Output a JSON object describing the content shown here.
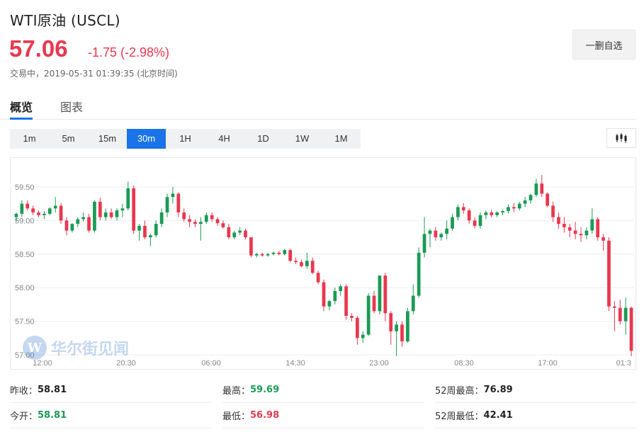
{
  "header": {
    "title": "WTI原油 (USCL)",
    "price": "57.06",
    "change": "-1.75 (-2.98%)",
    "status": "交易中，2019-05-31 01:39:35 (北京时间)"
  },
  "actions": {
    "watchlist_label": "一删自选"
  },
  "tabs": [
    {
      "label": "概览",
      "active": true
    },
    {
      "label": "图表",
      "active": false
    }
  ],
  "periods": [
    {
      "label": "1m",
      "active": false
    },
    {
      "label": "5m",
      "active": false
    },
    {
      "label": "15m",
      "active": false
    },
    {
      "label": "30m",
      "active": true
    },
    {
      "label": "1H",
      "active": false
    },
    {
      "label": "4H",
      "active": false
    },
    {
      "label": "1D",
      "active": false
    },
    {
      "label": "1W",
      "active": false
    },
    {
      "label": "1M",
      "active": false
    }
  ],
  "chart_type_icon": "candlestick-icon",
  "watermark": {
    "mark": "W",
    "text": "华尔街见闻"
  },
  "colors": {
    "up": "#1b9a55",
    "down": "#e8384f",
    "accent": "#1a73e8"
  },
  "chart_data": {
    "type": "candlestick",
    "ylim": [
      57.0,
      59.7
    ],
    "yticks": [
      "59.50",
      "59.00",
      "58.50",
      "58.00",
      "57.50",
      "57.00"
    ],
    "xticks": [
      "12:00",
      "20:30",
      "06:00",
      "14:30",
      "23:00",
      "08:30",
      "17:00",
      "01:3"
    ],
    "candles": [
      [
        59.05,
        59.12,
        58.98,
        59.1
      ],
      [
        59.1,
        59.3,
        59.05,
        59.25
      ],
      [
        59.25,
        59.3,
        59.15,
        59.18
      ],
      [
        59.18,
        59.22,
        59.08,
        59.12
      ],
      [
        59.12,
        59.15,
        59.05,
        59.08
      ],
      [
        59.08,
        59.14,
        59.02,
        59.1
      ],
      [
        59.1,
        59.2,
        59.08,
        59.18
      ],
      [
        59.18,
        59.35,
        59.12,
        59.22
      ],
      [
        59.22,
        59.26,
        58.95,
        59.0
      ],
      [
        59.0,
        59.05,
        58.78,
        58.85
      ],
      [
        58.85,
        58.96,
        58.82,
        58.95
      ],
      [
        58.95,
        59.05,
        58.9,
        59.02
      ],
      [
        59.02,
        59.12,
        58.98,
        59.05
      ],
      [
        59.05,
        59.1,
        58.82,
        58.85
      ],
      [
        58.85,
        59.3,
        58.82,
        59.28
      ],
      [
        59.28,
        59.34,
        59.0,
        59.05
      ],
      [
        59.05,
        59.18,
        59.0,
        59.12
      ],
      [
        59.12,
        59.18,
        59.02,
        59.05
      ],
      [
        59.05,
        59.18,
        59.0,
        59.15
      ],
      [
        59.15,
        59.25,
        59.05,
        59.18
      ],
      [
        59.18,
        59.58,
        59.15,
        59.48
      ],
      [
        59.48,
        59.52,
        58.8,
        58.85
      ],
      [
        58.85,
        58.95,
        58.7,
        58.92
      ],
      [
        58.92,
        59.0,
        58.72,
        58.75
      ],
      [
        58.75,
        58.8,
        58.62,
        58.78
      ],
      [
        58.78,
        59.0,
        58.75,
        58.95
      ],
      [
        58.95,
        59.18,
        58.9,
        59.12
      ],
      [
        59.12,
        59.4,
        59.05,
        59.35
      ],
      [
        59.35,
        59.5,
        59.25,
        59.4
      ],
      [
        59.4,
        59.42,
        59.05,
        59.12
      ],
      [
        59.12,
        59.18,
        58.98,
        59.02
      ],
      [
        59.02,
        59.08,
        58.9,
        58.98
      ],
      [
        58.98,
        59.02,
        58.9,
        58.95
      ],
      [
        58.95,
        59.05,
        58.7,
        58.98
      ],
      [
        58.98,
        59.12,
        58.95,
        59.08
      ],
      [
        59.08,
        59.12,
        58.98,
        59.02
      ],
      [
        59.02,
        59.05,
        58.92,
        58.96
      ],
      [
        58.96,
        59.0,
        58.88,
        58.9
      ],
      [
        58.9,
        58.95,
        58.72,
        58.75
      ],
      [
        58.75,
        58.85,
        58.72,
        58.82
      ],
      [
        58.82,
        58.9,
        58.78,
        58.85
      ],
      [
        58.85,
        58.88,
        58.72,
        58.75
      ],
      [
        58.75,
        58.72,
        58.45,
        58.48
      ],
      [
        58.48,
        58.52,
        58.45,
        58.5
      ],
      [
        58.5,
        58.52,
        58.46,
        58.48
      ],
      [
        58.48,
        58.52,
        58.46,
        58.5
      ],
      [
        58.5,
        58.54,
        58.48,
        58.52
      ],
      [
        58.52,
        58.55,
        58.48,
        58.5
      ],
      [
        58.5,
        58.58,
        58.48,
        58.56
      ],
      [
        58.56,
        58.58,
        58.38,
        58.4
      ],
      [
        58.4,
        58.45,
        58.35,
        58.38
      ],
      [
        58.38,
        58.42,
        58.3,
        58.32
      ],
      [
        58.32,
        58.52,
        58.28,
        58.4
      ],
      [
        58.4,
        58.45,
        58.2,
        58.22
      ],
      [
        58.22,
        58.25,
        58.05,
        58.08
      ],
      [
        58.08,
        58.12,
        57.65,
        57.72
      ],
      [
        57.72,
        57.82,
        57.66,
        57.8
      ],
      [
        57.8,
        58.0,
        57.75,
        57.95
      ],
      [
        57.95,
        58.05,
        57.88,
        58.02
      ],
      [
        58.02,
        58.05,
        57.52,
        57.58
      ],
      [
        57.58,
        57.62,
        57.5,
        57.55
      ],
      [
        57.55,
        57.58,
        57.15,
        57.25
      ],
      [
        57.25,
        57.35,
        57.18,
        57.3
      ],
      [
        57.3,
        57.92,
        57.28,
        57.88
      ],
      [
        57.88,
        57.95,
        57.62,
        57.65
      ],
      [
        57.65,
        58.18,
        57.6,
        58.18
      ],
      [
        58.18,
        58.22,
        57.5,
        57.62
      ],
      [
        57.62,
        57.65,
        57.15,
        57.35
      ],
      [
        57.35,
        57.5,
        56.98,
        57.45
      ],
      [
        57.45,
        57.5,
        57.12,
        57.2
      ],
      [
        57.2,
        57.7,
        57.18,
        57.65
      ],
      [
        57.65,
        58.05,
        57.6,
        57.88
      ],
      [
        57.88,
        58.6,
        57.85,
        58.52
      ],
      [
        58.52,
        59.05,
        58.45,
        58.8
      ],
      [
        58.8,
        58.88,
        58.6,
        58.85
      ],
      [
        58.85,
        58.9,
        58.7,
        58.75
      ],
      [
        58.75,
        58.82,
        58.7,
        58.8
      ],
      [
        58.8,
        59.0,
        58.72,
        58.88
      ],
      [
        58.88,
        59.1,
        58.85,
        59.05
      ],
      [
        59.05,
        59.24,
        59.0,
        59.2
      ],
      [
        59.2,
        59.26,
        59.1,
        59.15
      ],
      [
        59.15,
        59.18,
        58.95,
        59.0
      ],
      [
        59.0,
        59.05,
        58.88,
        58.92
      ],
      [
        58.92,
        59.12,
        58.88,
        59.08
      ],
      [
        59.08,
        59.15,
        59.02,
        59.12
      ],
      [
        59.12,
        59.16,
        59.05,
        59.08
      ],
      [
        59.08,
        59.14,
        59.05,
        59.12
      ],
      [
        59.12,
        59.16,
        59.08,
        59.14
      ],
      [
        59.14,
        59.24,
        59.1,
        59.2
      ],
      [
        59.2,
        59.26,
        59.12,
        59.18
      ],
      [
        59.18,
        59.28,
        59.15,
        59.25
      ],
      [
        59.25,
        59.35,
        59.2,
        59.3
      ],
      [
        59.3,
        59.4,
        59.25,
        59.38
      ],
      [
        59.38,
        59.62,
        59.35,
        59.55
      ],
      [
        59.55,
        59.68,
        59.35,
        59.4
      ],
      [
        59.4,
        59.42,
        59.2,
        59.22
      ],
      [
        59.22,
        59.28,
        58.98,
        59.05
      ],
      [
        59.05,
        59.12,
        58.88,
        58.95
      ],
      [
        58.95,
        59.05,
        58.82,
        58.9
      ],
      [
        58.9,
        58.95,
        58.75,
        58.85
      ],
      [
        58.85,
        58.98,
        58.72,
        58.8
      ],
      [
        58.8,
        58.9,
        58.68,
        58.78
      ],
      [
        58.78,
        58.9,
        58.72,
        58.85
      ],
      [
        58.85,
        59.18,
        58.8,
        59.02
      ],
      [
        59.02,
        59.05,
        58.7,
        58.75
      ],
      [
        58.75,
        58.8,
        58.55,
        58.7
      ],
      [
        58.7,
        58.75,
        57.65,
        57.72
      ],
      [
        57.72,
        57.8,
        57.35,
        57.7
      ],
      [
        57.7,
        57.82,
        57.45,
        57.5
      ],
      [
        57.5,
        57.85,
        57.3,
        57.7
      ],
      [
        57.7,
        57.72,
        56.98,
        57.06
      ]
    ]
  },
  "stats": [
    {
      "label": "昨收：",
      "value": "58.81",
      "tone": "dark"
    },
    {
      "label": "最高：",
      "value": "59.69",
      "tone": "green"
    },
    {
      "label": "52周最高：",
      "value": "76.89",
      "tone": "dark"
    },
    {
      "label": "今开：",
      "value": "58.81",
      "tone": "green"
    },
    {
      "label": "最低：",
      "value": "56.98",
      "tone": "red"
    },
    {
      "label": "52周最低：",
      "value": "42.41",
      "tone": "dark"
    }
  ]
}
